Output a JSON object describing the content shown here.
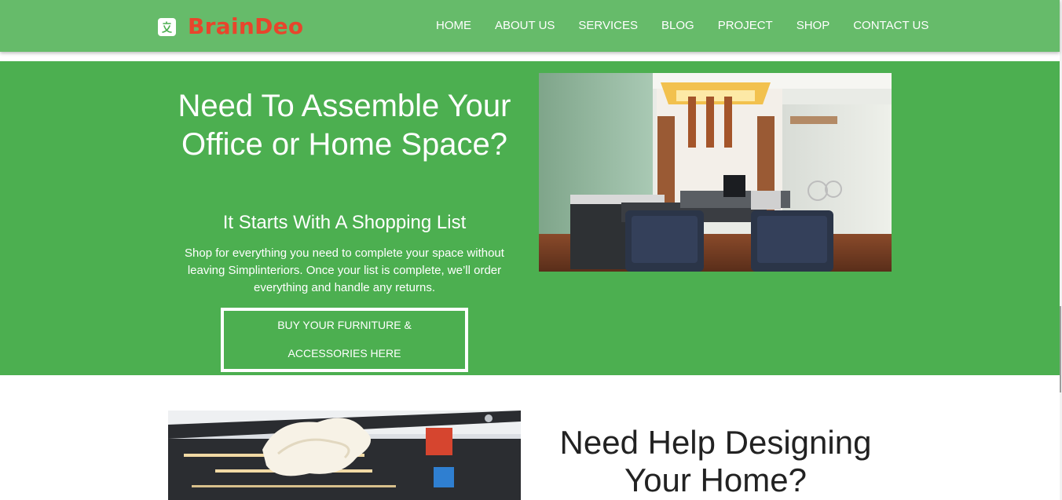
{
  "header": {
    "brand": "BrainDeo",
    "logo_icon": "brand-logo-icon",
    "nav": [
      "HOME",
      "ABOUT US",
      "SERVICES",
      "BLOG",
      "PROJECT",
      "SHOP",
      "CONTACT US"
    ]
  },
  "hero": {
    "title": "Need To Assemble Your Office or Home Space?",
    "subtitle": "It Starts With A Shopping List",
    "description": "Shop for everything you need to complete your space without leaving Simplinteriors. Once your list is complete, we’ll order everything and handle any returns.",
    "button": "BUY YOUR FURNITURE & ACCESSORIES HERE"
  },
  "section2": {
    "title": "Need Help Designing Your Home?"
  },
  "colors": {
    "header_bg": "#66bb6a",
    "hero_bg": "#4caf50",
    "brand": "#e8452c"
  }
}
